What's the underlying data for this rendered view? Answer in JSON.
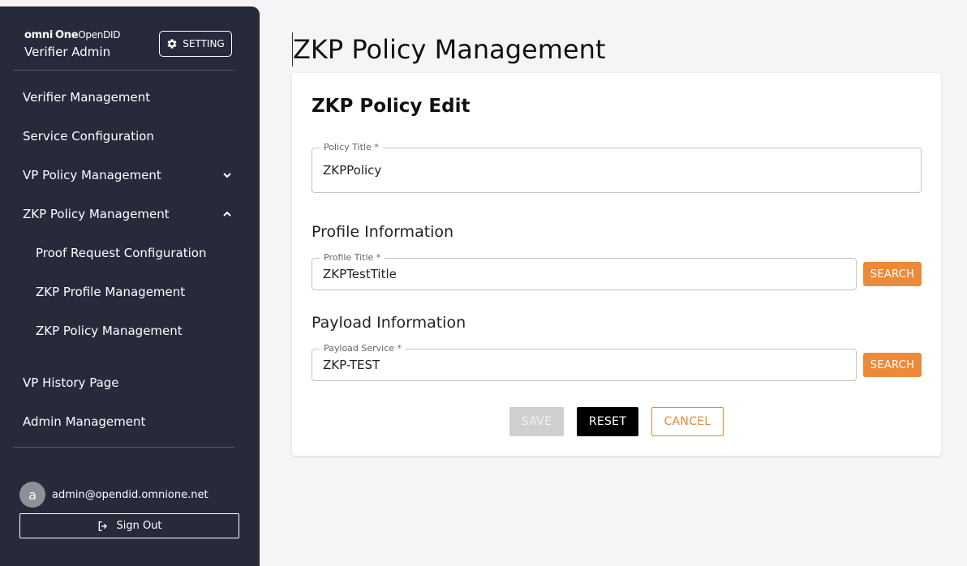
{
  "brand": {
    "logo_omni": "omni",
    "logo_one": "One",
    "logo_open": "OpenDID",
    "subtitle": "Verifier Admin"
  },
  "setting_button": {
    "label": "SETTING",
    "icon": "gear-icon"
  },
  "nav": {
    "items": [
      {
        "label": "Verifier Management"
      },
      {
        "label": "Service Configuration"
      },
      {
        "label": "VP Policy Management",
        "chevron": "down"
      },
      {
        "label": "ZKP Policy Management",
        "chevron": "up"
      },
      {
        "label": "Proof Request Configuration"
      },
      {
        "label": "ZKP Profile Management"
      },
      {
        "label": "ZKP Policy Management"
      },
      {
        "label": "VP History Page"
      },
      {
        "label": "Admin Management"
      }
    ]
  },
  "user": {
    "avatar_letter": "a",
    "email": "admin@opendid.omnione.net",
    "sign_out": "Sign Out"
  },
  "page": {
    "title": "ZKP Policy Management"
  },
  "form": {
    "title": "ZKP Policy Edit",
    "policy_title": {
      "label": "Policy Title *",
      "value": "ZKPPolicy"
    },
    "profile_section": "Profile Information",
    "profile_title": {
      "label": "Profile Title *",
      "value": "ZKPTestTitle"
    },
    "profile_search": "SEARCH",
    "payload_section": "Payload Information",
    "payload_service": {
      "label": "Payload Service *",
      "value": "ZKP-TEST"
    },
    "payload_search": "SEARCH",
    "buttons": {
      "save": "SAVE",
      "reset": "RESET",
      "cancel": "CANCEL"
    }
  },
  "colors": {
    "sidebar_bg": "#262a3b",
    "accent_orange": "#ec8a3a",
    "page_bg": "#f5f5f5"
  }
}
